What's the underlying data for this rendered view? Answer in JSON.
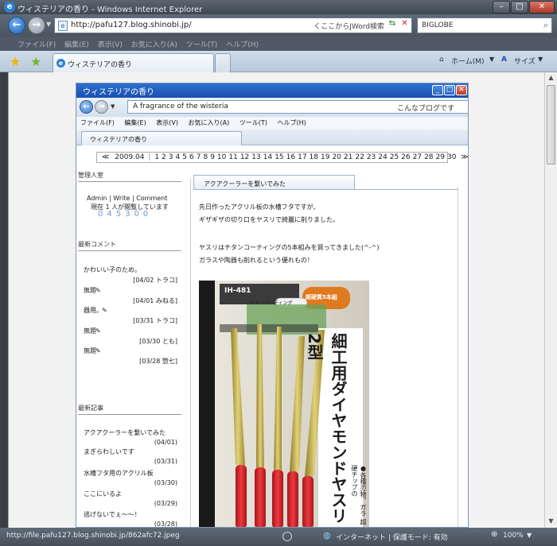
{
  "window": {
    "title": "ウィステリアの香り - Windows Internet Explorer"
  },
  "address": {
    "url": "http://pafu127.blog.shinobi.jp/",
    "hint": "くここからJWord検索"
  },
  "search": {
    "value": "BIGLOBE"
  },
  "menu": [
    "ファイル(F)",
    "編集(E)",
    "表示(V)",
    "お気に入り(A)",
    "ツール(T)",
    "ヘルプ(H)"
  ],
  "tabs": {
    "active": "ウィステリアの香り"
  },
  "commands": {
    "home": "ホーム(M)",
    "site": "サイズ"
  },
  "inner": {
    "title": "ウィステリアの香り",
    "address": "A fragrance of the wisteria",
    "address_hint": "こんなブログです",
    "menu": [
      "ファイル(F)",
      "編集(E)",
      "表示(V)",
      "お気に入り(A)",
      "ツール(T)",
      "ヘルプ(H)"
    ],
    "tab": "ウィステリアの香り"
  },
  "pager": {
    "prev": "≪",
    "month": "2009.04",
    "days": [
      "1",
      "2",
      "3",
      "4",
      "5",
      "6",
      "7",
      "8",
      "9",
      "10",
      "11",
      "12",
      "13",
      "14",
      "15",
      "16",
      "17",
      "18",
      "19",
      "20",
      "21",
      "22",
      "23",
      "24",
      "25",
      "26",
      "27",
      "28",
      "29",
      "30"
    ],
    "next": "≫"
  },
  "sidebar": {
    "admin_heading": "管理人室",
    "admin_links": [
      "Admin",
      "Write",
      "Comment"
    ],
    "viewing": "現在 1 人が閲覧しています",
    "counter": "045300",
    "comments_heading": "最新コメント",
    "comments": [
      {
        "title": "かわいい子のため。",
        "meta": "[04/02 トラコ]"
      },
      {
        "title": "無題",
        "meta": "[04/01 みねる]"
      },
      {
        "title": "器用。",
        "meta": "[03/31 トラコ]"
      },
      {
        "title": "無題",
        "meta": "[03/30 とも]"
      },
      {
        "title": "無題",
        "meta": "[03/28 惣七]"
      }
    ],
    "posts_heading": "最新記事",
    "posts": [
      {
        "title": "アクアクーラーを繋いでみた",
        "date": "(04/01)"
      },
      {
        "title": "まぎらわしいです",
        "date": "(03/31)"
      },
      {
        "title": "水槽フタ用のアクリル板",
        "date": "(03/30)"
      },
      {
        "title": "ここにいるよ",
        "date": "(03/29)"
      },
      {
        "title": "逃げないでぇ～～！",
        "date": "(03/28)"
      }
    ]
  },
  "article": {
    "tab": "アクアクーラーを繋いでみた",
    "lines": [
      "先日作ったアクリル板の水槽フタですが、",
      "ギザギザの切り口をヤスリで綺麗に削りました。",
      "",
      "ヤスリはチタンコーティングの5本組みを買ってきました(^-^)",
      "ガラスや陶器も削れるという優れもの！"
    ],
    "photo_label_model": "IH-481",
    "photo_label_badge": "チタンコーティング",
    "photo_label_count": "超硬質5本組",
    "photo_vertical": "細工用ダイヤモンドヤスリ 2型",
    "photo_side": "●各種刃物、ガラ 超硬チップの"
  },
  "status": {
    "url": "http://file.pafu127.blog.shinobi.jp/862afc72.jpeg",
    "zone": "インターネット | 保護モード: 有効",
    "zoom": "100%"
  },
  "colors": {
    "titlebar": "#4d5865",
    "inner_title": "#2563c8",
    "red_grip": "#d8232a",
    "gold_file": "#c9b54a"
  }
}
